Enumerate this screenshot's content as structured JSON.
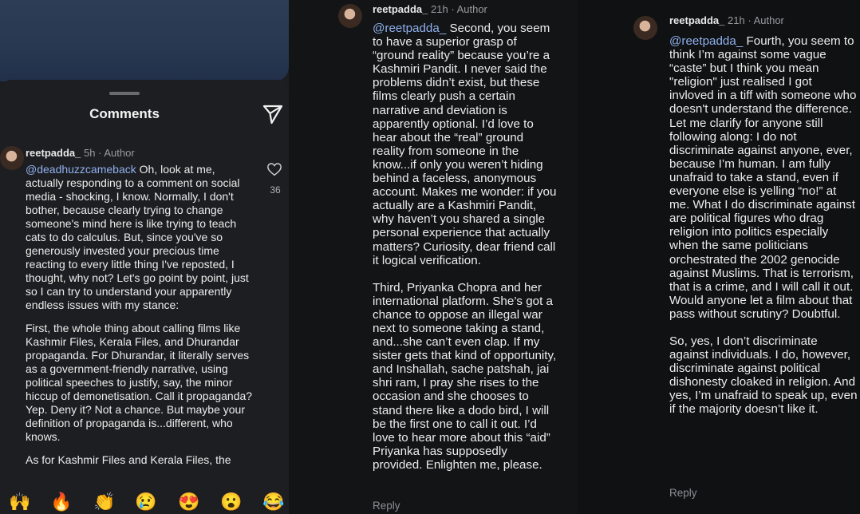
{
  "panel1": {
    "sheet_title": "Comments",
    "comment": {
      "username": "reetpadda_",
      "time": "5h",
      "sep": "·",
      "author_label": "Author",
      "mention": "@deadhuzzcameback",
      "para1": " Oh, look at me, actually responding to a comment on social media - shocking, I know. Normally, I don't bother, because clearly trying to change someone's mind here is like trying to teach cats to do calculus. But, since you've so generously invested your precious time reacting to every little thing I've reposted, I thought, why not? Let's go point by point, just so I can try to understand your apparently endless issues with my stance:",
      "para2": "First, the whole thing about calling films like Kashmir Files, Kerala Files, and Dhurandar propaganda. For Dhurandar, it literally serves as a government-friendly narrative, using political speeches to justify, say, the minor hiccup of demonetisation. Call it propaganda? Yep. Deny it? Not a chance. But maybe your definition of propaganda is...different, who knows.",
      "para3": "As for Kashmir Files and Kerala Files, the",
      "like_count": "36"
    },
    "emojis": [
      "🙌",
      "🔥",
      "👏",
      "😢",
      "😍",
      "😮",
      "😂"
    ]
  },
  "panel2": {
    "username": "reetpadda_",
    "time": "21h",
    "sep": "·",
    "author_label": "Author",
    "mention": "@reetpadda_",
    "para1": " Second, you seem to have a superior grasp of “ground reality” because you’re a Kashmiri Pandit. I never said the problems didn’t exist, but these films clearly push a certain narrative and deviation is apparently optional. I’d love to hear about the “real” ground reality from someone in the know...if only you weren’t hiding behind a faceless, anonymous account. Makes me wonder: if you actually are a Kashmiri Pandit, why haven’t you shared a single personal experience that actually matters? Curiosity, dear friend call it logical verification.",
    "para2": "Third, Priyanka Chopra and her international platform. She’s got a chance to oppose an illegal war next to someone taking a stand, and...she can’t even clap. If my sister gets that kind of opportunity, and Inshallah, sache patshah, jai shri ram, I pray she rises to the occasion and she chooses to stand there like a dodo bird, I will be the first one to call it out. I’d love to hear more about this “aid” Priyanka has supposedly provided. Enlighten me, please.",
    "reply_label": "Reply"
  },
  "panel3": {
    "username": "reetpadda_",
    "time": "21h",
    "sep": "·",
    "author_label": "Author",
    "mention": "@reetpadda_",
    "para1": " Fourth, you seem to think I’m against some vague “caste” but I think you mean \"religion\" just realised I got invloved in a tiff with someone who doesn't understand the difference. Let me clarify for anyone still following along: I do not discriminate against anyone, ever, because I’m human. I am fully unafraid to take a stand, even if everyone else is yelling “no!” at me. What I do discriminate against are political figures who drag religion into politics especially when the same politicians orchestrated the 2002 genocide against Muslims. That is terrorism, that is a crime, and I will call it out. Would anyone let a film about that pass without scrutiny? Doubtful.",
    "para2": "So, yes, I don’t discriminate against individuals. I do, however, discriminate against political dishonesty cloaked in religion. And yes, I’m unafraid to speak up, even if the majority doesn’t like it.",
    "reply_label": "Reply"
  },
  "colors": {
    "mention": "#8fb0ef",
    "text": "#ececec",
    "meta": "#9a9b9f"
  },
  "icons": [
    "send-icon",
    "heart-icon",
    "avatar"
  ]
}
